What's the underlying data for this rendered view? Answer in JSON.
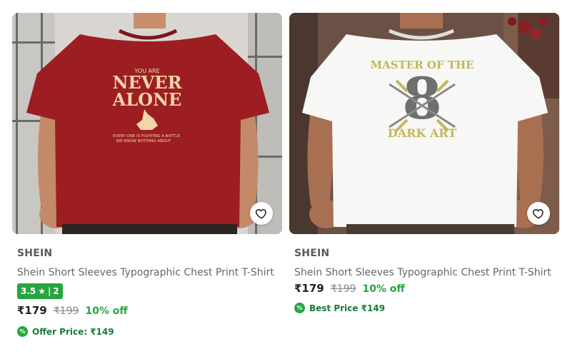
{
  "products": [
    {
      "brand": "SHEIN",
      "title": "Shein Short Sleeves Typographic Chest Print T-Shirt",
      "rating": "3.5",
      "rating_star": "★",
      "rating_sep": "|",
      "rating_count": "2",
      "price": "₹179",
      "mrp": "₹199",
      "discount": "10% off",
      "offer_label": "Offer Price: ₹149",
      "shirt_text": [
        "YOU ARE",
        "NEVER",
        "ALONE",
        "EVERY ONE IS FIGHTING A BATTLE",
        "WE KNOW NOTHING ABOUT"
      ],
      "shirt_color": "#9c1e22",
      "print_color": "#f2d5a8"
    },
    {
      "brand": "SHEIN",
      "title": "Shein Short Sleeves Typographic Chest Print T-Shirt",
      "price": "₹179",
      "mrp": "₹199",
      "discount": "10% off",
      "offer_label": "Best Price ₹149",
      "shirt_text": [
        "MASTER OF THE",
        "8",
        "DARK ART"
      ],
      "shirt_color": "#f7f7f5",
      "print_color": "#c2b75a"
    }
  ],
  "icons": {
    "wishlist": "heart-outline-icon",
    "offer": "percent-badge-icon"
  },
  "colors": {
    "rating_bg": "#26a541",
    "discount": "#26a541"
  }
}
